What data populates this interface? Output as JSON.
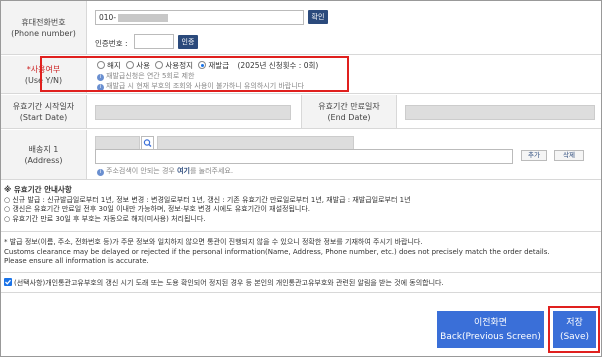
{
  "phone": {
    "label_ko": "휴대전화번호",
    "label_en": "(Phone number)",
    "value_prefix": "010-",
    "confirm_label": "확인",
    "auth_label": "인증번호 :",
    "auth_button": "인증"
  },
  "usage": {
    "label_ko": "*사용여부",
    "label_en": "(Use Y/N)",
    "options": [
      "해지",
      "사용",
      "사용정지",
      "재발급"
    ],
    "selected": "재발급",
    "count_text": "(2025년 신청횟수 : 0회)",
    "notes": [
      "재발급신청은 연간 5회로 제한",
      "재발급 시 현재 부호의 조회와 사용이 불가하니 유의하시기 바랍니다"
    ]
  },
  "validity": {
    "start_ko": "유효기간 시작일자",
    "start_en": "(Start Date)",
    "end_ko": "유효기간 만료일자",
    "end_en": "(End Date)"
  },
  "address": {
    "label_ko": "배송지 1",
    "label_en": "(Address)",
    "hint_prefix": "주소검색이 안되는 경우 ",
    "hint_link": "여기",
    "hint_suffix": "를 눌러주세요.",
    "add_button": "추가",
    "delete_button": "삭제"
  },
  "validity_notice": {
    "title": "※ 유효기간 안내사항",
    "lines": [
      "○ 신규 발급 : 신규발급일로부터 1년, 정보 변경 : 변경일로부터 1년, 갱신 : 기존 유효기간 만료일로부터 1년, 재발급 : 재발급일로부터 1년",
      "○ 갱신은 유효기간 만료일 전후 30일 이내만 가능하며, 정보·부호 변경 시에도 유효기간이 재설정됩니다.",
      "○ 유효기간 만료 30일 후 부호는 자동으로 해지(미사용) 처리됩니다."
    ]
  },
  "accuracy_notice": {
    "lines": [
      "* 발급 정보(이름, 주소, 전화번호 등)가 주문 정보와 일치하지 않으면 통관이 진행되지 않을 수 있으니 정확한 정보를 기재하여 주시기 바랍니다.",
      "Customs clearance may be delayed or rejected if the personal information(Name, Address, Phone number, etc.) does not precisely match the order details.",
      "Please ensure all information is accurate."
    ]
  },
  "consent": {
    "text": "(선택사항)개인통관고유부호의 갱신 시기 도래 또는 도용 확인되어 정지된 경우 등 본인의 개인통관고유부호와 관련된 알림을 받는 것에 동의합니다.",
    "checked": true
  },
  "footer": {
    "back_ko": "이전화면",
    "back_en": "Back(Previous Screen)",
    "save_ko": "저장",
    "save_en": "(Save)"
  },
  "colors": {
    "accent": "#3a6fd8",
    "navy": "#2b4a7c",
    "highlight": "#e0201e"
  }
}
